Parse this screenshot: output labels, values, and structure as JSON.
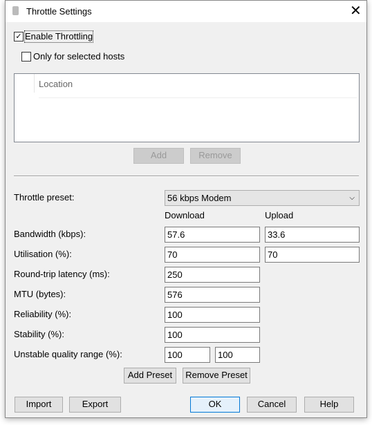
{
  "dialog": {
    "title": "Throttle Settings",
    "close_icon": "close-icon"
  },
  "enable_throttling": {
    "label": "Enable Throttling",
    "checked": true
  },
  "only_selected_hosts": {
    "label": "Only for selected hosts",
    "checked": false
  },
  "hosts_table": {
    "columns": [
      "",
      "Location"
    ],
    "rows": []
  },
  "hosts_buttons": {
    "add": "Add",
    "remove": "Remove"
  },
  "preset": {
    "label": "Throttle preset:",
    "value": "56 kbps Modem"
  },
  "columns": {
    "download": "Download",
    "upload": "Upload"
  },
  "fields": [
    {
      "label": "Bandwidth (kbps):",
      "download": "57.6",
      "upload": "33.6"
    },
    {
      "label": "Utilisation (%):",
      "download": "70",
      "upload": "70"
    },
    {
      "label": "Round-trip latency (ms):",
      "download": "250"
    },
    {
      "label": "MTU (bytes):",
      "download": "576"
    },
    {
      "label": "Reliability (%):",
      "download": "100"
    },
    {
      "label": "Stability (%):",
      "download": "100"
    },
    {
      "label": "Unstable quality range (%):",
      "min": "100",
      "max": "100"
    }
  ],
  "preset_buttons": {
    "add": "Add Preset",
    "remove": "Remove Preset"
  },
  "footer": {
    "import": "Import",
    "export": "Export",
    "ok": "OK",
    "cancel": "Cancel",
    "help": "Help"
  }
}
